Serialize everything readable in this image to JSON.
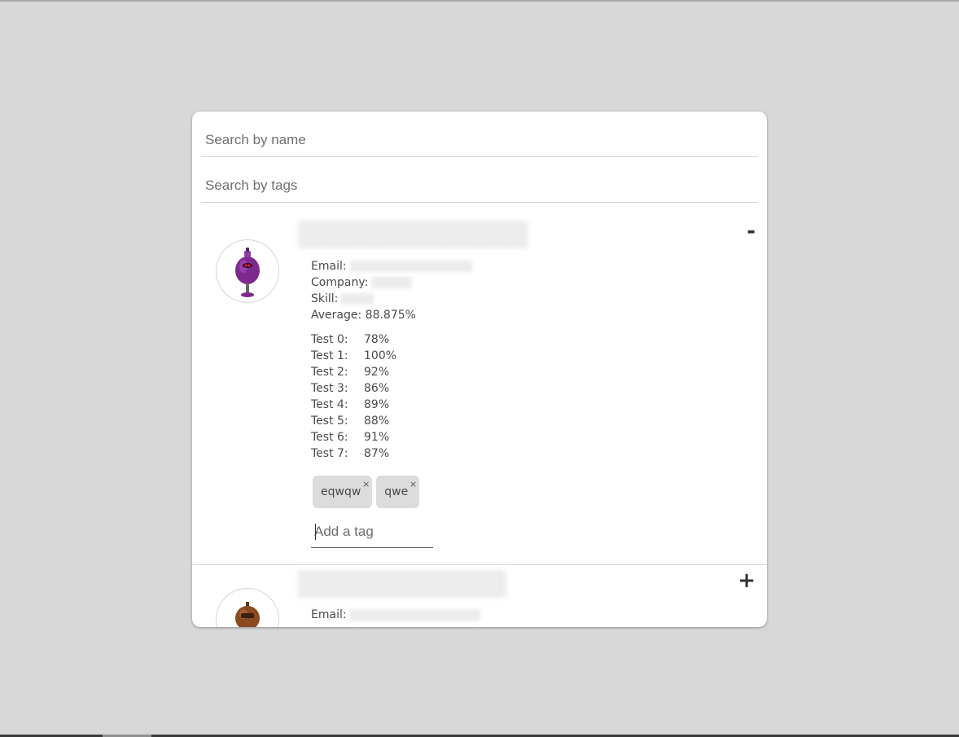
{
  "search": {
    "name_placeholder": "Search by name",
    "tags_placeholder": "Search by tags"
  },
  "students": [
    {
      "toggle": "-",
      "labels": {
        "email": "Email:",
        "company": "Company:",
        "skill": "Skill:",
        "average": "Average: 88.875%"
      },
      "tests": [
        {
          "label": "Test 0:",
          "value": "78%"
        },
        {
          "label": "Test 1:",
          "value": "100%"
        },
        {
          "label": "Test 2:",
          "value": "92%"
        },
        {
          "label": "Test 3:",
          "value": "86%"
        },
        {
          "label": "Test 4:",
          "value": "89%"
        },
        {
          "label": "Test 5:",
          "value": "88%"
        },
        {
          "label": "Test 6:",
          "value": "91%"
        },
        {
          "label": "Test 7:",
          "value": "87%"
        }
      ],
      "tags": [
        {
          "text": "eqwqw",
          "remove": "×"
        },
        {
          "text": "qwe",
          "remove": "×"
        }
      ],
      "add_tag_placeholder": "Add a tag",
      "avatar_icon": "purple-robot-avatar-icon"
    },
    {
      "toggle": "+",
      "labels": {
        "email": "Email:"
      },
      "avatar_icon": "brown-robot-avatar-icon"
    }
  ],
  "colors": {
    "page_background": "#d8d8d8",
    "card_background": "#ffffff",
    "tag_background": "#dcdcdc",
    "text": "#4a4a4a"
  }
}
